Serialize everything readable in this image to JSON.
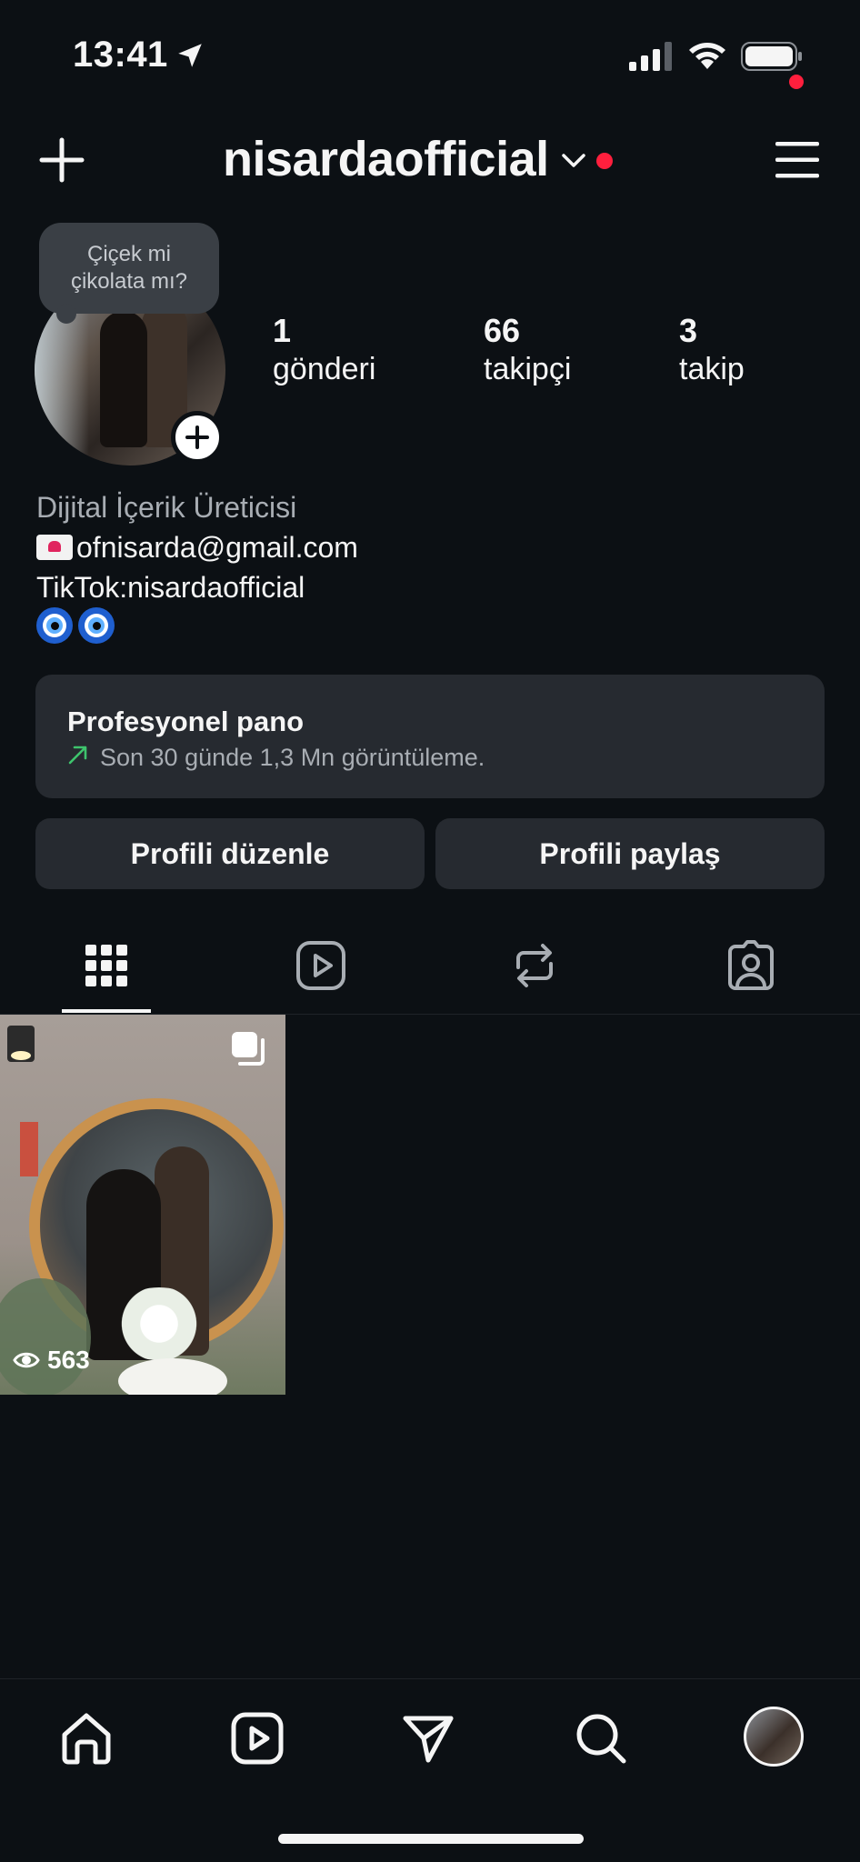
{
  "status_bar": {
    "time": "13:41"
  },
  "header": {
    "username": "nisardaofficial"
  },
  "note": {
    "line1": "Çiçek mi",
    "line2": "çikolata mı?"
  },
  "stats": {
    "posts_value": "1",
    "posts_label": "gönderi",
    "followers_value": "66",
    "followers_label": "takipçi",
    "following_value": "3",
    "following_label": "takip"
  },
  "bio": {
    "category": "Dijital İçerik Üreticisi",
    "email": "ofnisarda@gmail.com",
    "tiktok": "TikTok:nisardaofficial"
  },
  "dashboard": {
    "title": "Profesyonel pano",
    "subtitle": "Son 30 günde 1,3 Mn görüntüleme."
  },
  "buttons": {
    "edit": "Profili düzenle",
    "share": "Profili paylaş"
  },
  "tabs": [
    "grid-icon",
    "reels-icon",
    "reposts-icon",
    "tagged-icon"
  ],
  "posts": [
    {
      "views": "563",
      "type": "carousel"
    }
  ],
  "colors": {
    "background": "#0c1014",
    "card": "#262a30",
    "accent_red": "#ff1f3d",
    "trend_green": "#3ec46d"
  }
}
